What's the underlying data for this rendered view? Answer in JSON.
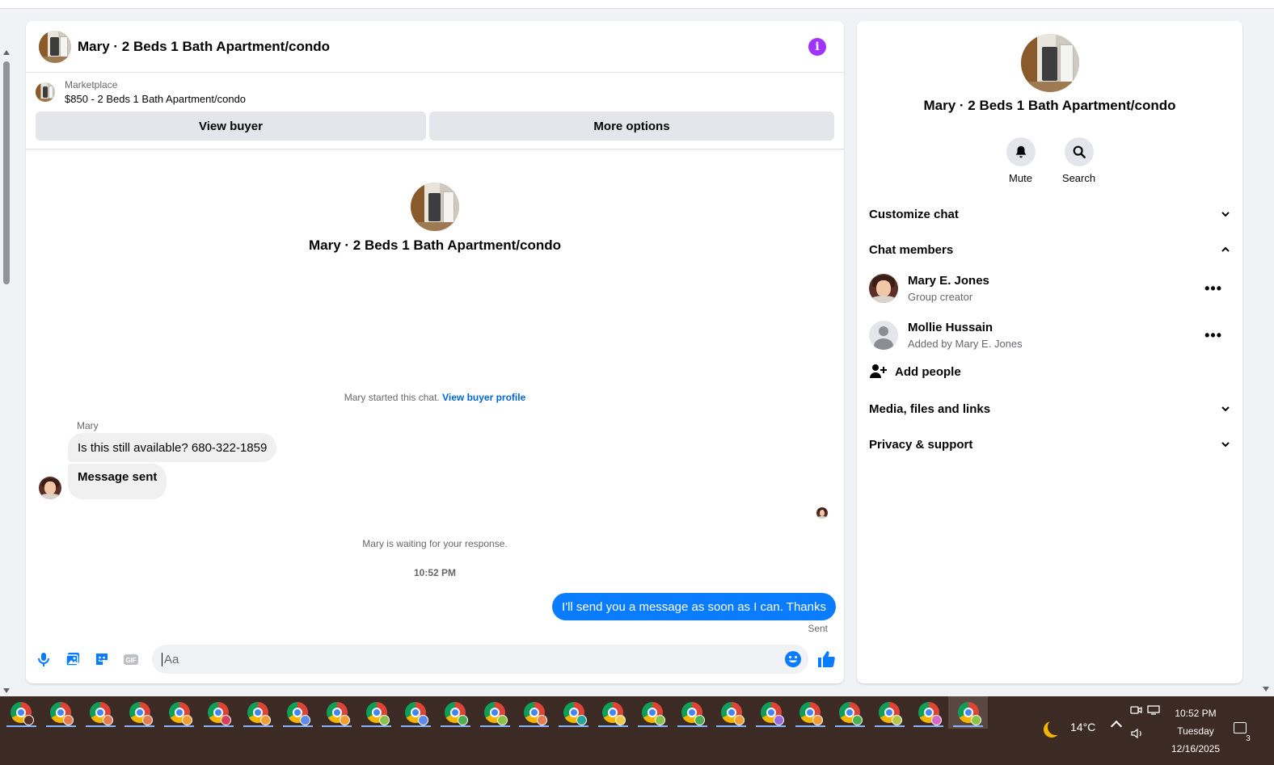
{
  "chat": {
    "title": "Mary · 2 Beds 1 Bath Apartment/condo",
    "listing": {
      "source": "Marketplace",
      "price_title": "$850 - 2 Beds 1 Bath Apartment/condo"
    },
    "buttons": {
      "view_buyer": "View buyer",
      "more_options": "More options"
    },
    "intro_title": "Mary · 2 Beds 1 Bath Apartment/condo",
    "started_text": "Mary started this chat.",
    "view_buyer_profile": "View buyer profile",
    "sender_name": "Mary",
    "messages": {
      "incoming_1": "Is this still available? 680-322-1859",
      "incoming_2": "Message sent",
      "outgoing_1": "I'll send you a message as soon as I can. Thanks"
    },
    "waiting_text": "Mary is waiting for your response.",
    "timestamp": "10:52 PM",
    "sent_status": "Sent",
    "composer_placeholder": "Aa"
  },
  "side": {
    "title": "Mary · 2 Beds 1 Bath Apartment/condo",
    "actions": {
      "mute": "Mute",
      "search": "Search"
    },
    "sections": {
      "customize": "Customize chat",
      "members": "Chat members",
      "media": "Media, files and links",
      "privacy": "Privacy & support"
    },
    "members": [
      {
        "name": "Mary E. Jones",
        "role": "Group creator"
      },
      {
        "name": "Mollie Hussain",
        "role": "Added by Mary E. Jones"
      }
    ],
    "add_people": "Add people"
  },
  "taskbar": {
    "temperature": "14°C",
    "time": "10:52 PM",
    "day": "Tuesday",
    "date": "12/16/2025",
    "notifications": "3"
  },
  "colors": {
    "messenger_blue": "#0a7cff",
    "info_purple": "#a033ff",
    "link_blue": "#0064d1"
  }
}
